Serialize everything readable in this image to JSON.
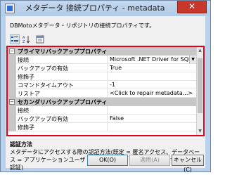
{
  "window": {
    "title": "メタデータ 接続プロパティ - metadata",
    "close_glyph": "✕"
  },
  "description": "DBMotoメタデータ・リポジトリの接続プロパティです。",
  "toolbar": {
    "buttons": [
      {
        "icon": "categorized-sort-icon"
      },
      {
        "icon": "alphabetical-sort-icon"
      },
      {
        "icon": "property-pages-icon"
      }
    ]
  },
  "grid": {
    "primary_category": "プライマリバックアッププロパティ",
    "secondary_category": "セカンダリバックアッププロパティ",
    "primary_rows": [
      {
        "name": "接続",
        "value": "Microsoft .NET Driver for SQL Server C"
      },
      {
        "name": "バックアップの有効",
        "value": "True"
      },
      {
        "name": "修飾子",
        "value": ""
      },
      {
        "name": "コマンドタイムアウト",
        "value": "-1"
      },
      {
        "name": "リストア",
        "value": "<Click to repair metadata...>"
      }
    ],
    "secondary_rows": [
      {
        "name": "接続",
        "value": ""
      },
      {
        "name": "バックアップの有効",
        "value": "False"
      },
      {
        "name": "修飾子",
        "value": ""
      }
    ],
    "collapse_glyph": "−"
  },
  "help": {
    "title": "認証方法",
    "text": "メタデータにアクセスする際の認証方法(既定 = 匿名アクセス、データベース = アプリケーションユーザ 又は 'Windows' = ドメインユーザに基づく認証)"
  },
  "buttons": {
    "ok": "OK(O)",
    "apply": "適用(A)",
    "cancel": "キャンセル(C)"
  },
  "colors": {
    "highlight_border": "#e0001a",
    "close_button": "#c7382b"
  }
}
